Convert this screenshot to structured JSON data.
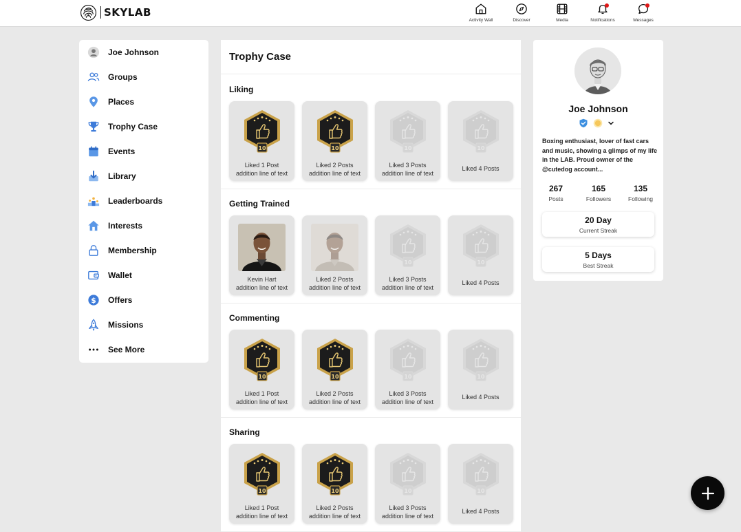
{
  "brand": {
    "name": "SKYLAB"
  },
  "topnav": [
    {
      "label": "Activity Wall",
      "icon": "home-icon",
      "dot": false
    },
    {
      "label": "Discover",
      "icon": "compass-icon",
      "dot": false
    },
    {
      "label": "Media",
      "icon": "film-icon",
      "dot": false
    },
    {
      "label": "Notifications",
      "icon": "bell-icon",
      "dot": true
    },
    {
      "label": "Messages",
      "icon": "chat-icon",
      "dot": true
    }
  ],
  "sidebar": {
    "items": [
      {
        "label": "Joe Johnson",
        "icon": "avatar"
      },
      {
        "label": "Groups",
        "icon": "people-icon"
      },
      {
        "label": "Places",
        "icon": "map-pin-icon"
      },
      {
        "label": "Trophy Case",
        "icon": "trophy-icon"
      },
      {
        "label": "Events",
        "icon": "calendar-icon"
      },
      {
        "label": "Library",
        "icon": "download-icon"
      },
      {
        "label": "Leaderboards",
        "icon": "podium-icon"
      },
      {
        "label": "Interests",
        "icon": "house-icon"
      },
      {
        "label": "Membership",
        "icon": "lock-icon"
      },
      {
        "label": "Wallet",
        "icon": "wallet-icon"
      },
      {
        "label": "Offers",
        "icon": "dollar-icon"
      },
      {
        "label": "Missions",
        "icon": "rocket-icon"
      },
      {
        "label": "See More",
        "icon": "more-dots-icon"
      }
    ]
  },
  "trophy_case": {
    "title": "Trophy Case",
    "badge_level": "10",
    "sections": [
      {
        "title": "Liking",
        "cards": [
          {
            "line1": "Liked 1 Post",
            "line2": "addition line of text",
            "kind": "earned"
          },
          {
            "line1": "Liked 2 Posts",
            "line2": "addition line of text",
            "kind": "earned"
          },
          {
            "line1": "Liked 3 Posts",
            "line2": "addition line of text",
            "kind": "locked"
          },
          {
            "line1": "Liked 4 Posts",
            "line2": "",
            "kind": "locked"
          }
        ]
      },
      {
        "title": "Getting Trained",
        "cards": [
          {
            "line1": "Kevin Hart",
            "line2": "addition line of text",
            "kind": "photo"
          },
          {
            "line1": "Liked 2 Posts",
            "line2": "addition line of text",
            "kind": "photo-faded"
          },
          {
            "line1": "Liked 3 Posts",
            "line2": "addition line of text",
            "kind": "locked"
          },
          {
            "line1": "Liked 4 Posts",
            "line2": "",
            "kind": "locked"
          }
        ]
      },
      {
        "title": "Commenting",
        "cards": [
          {
            "line1": "Liked 1 Post",
            "line2": "addition line of text",
            "kind": "earned"
          },
          {
            "line1": "Liked 2 Posts",
            "line2": "addition line of text",
            "kind": "earned"
          },
          {
            "line1": "Liked 3 Posts",
            "line2": "addition line of text",
            "kind": "locked"
          },
          {
            "line1": "Liked 4 Posts",
            "line2": "",
            "kind": "locked"
          }
        ]
      },
      {
        "title": "Sharing",
        "cards": [
          {
            "line1": "Liked 1 Post",
            "line2": "addition line of text",
            "kind": "earned"
          },
          {
            "line1": "Liked 2 Posts",
            "line2": "addition line of text",
            "kind": "earned"
          },
          {
            "line1": "Liked 3 Posts",
            "line2": "addition line of text",
            "kind": "locked"
          },
          {
            "line1": "Liked 4 Posts",
            "line2": "",
            "kind": "locked"
          }
        ]
      }
    ]
  },
  "profile": {
    "name": "Joe Johnson",
    "bio": "Boxing enthusiast, lover of fast cars and music, showing a glimps of my life in the LAB. Proud owner of the @cutedog account...",
    "stats": [
      {
        "value": "267",
        "label": "Posts"
      },
      {
        "value": "165",
        "label": "Followers"
      },
      {
        "value": "135",
        "label": "Following"
      }
    ],
    "streaks": [
      {
        "value": "20 Day",
        "label": "Current Streak"
      },
      {
        "value": "5 Days",
        "label": "Best Streak"
      }
    ]
  },
  "colors": {
    "accent_blue": "#3d7bd9",
    "notification_dot": "#e01818",
    "badge_gold": "#c9a24a",
    "badge_dark": "#1c1c1c"
  }
}
